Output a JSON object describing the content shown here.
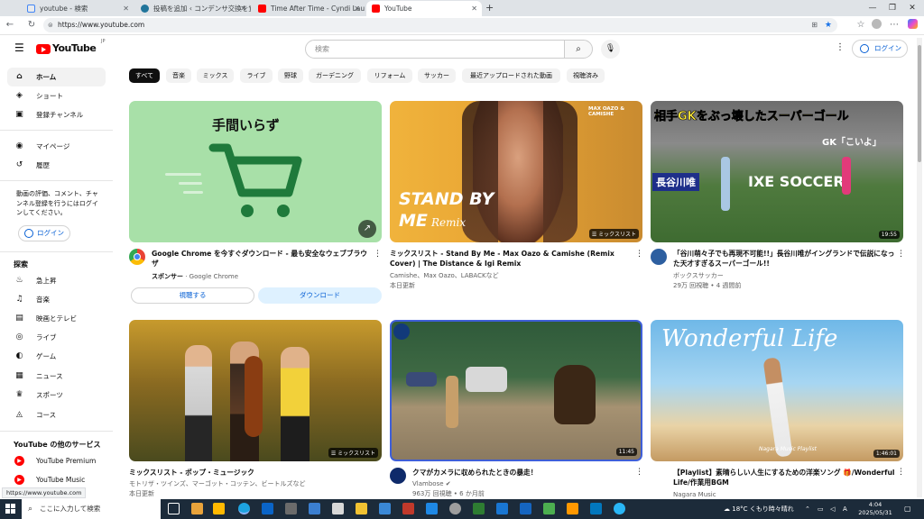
{
  "browser": {
    "tabs": [
      {
        "title": "youtube - 検索",
        "color": "#4285f4"
      },
      {
        "title": "投稿を追加 ‹ コンデンサ交換を覚え…",
        "color": "#21759b"
      },
      {
        "title": "Time After Time - Cyndi Lauper (L…",
        "color": "#ff0000"
      },
      {
        "title": "YouTube",
        "color": "#ff0000"
      }
    ],
    "new_tab": "+",
    "url": "https://www.youtube.com",
    "status_url": "https://www.youtube.com"
  },
  "youtube": {
    "logo_text": "YouTube",
    "logo_region": "JP",
    "search_placeholder": "検索",
    "login_label": "ログイン",
    "sidebar": {
      "main": [
        {
          "label": "ホーム",
          "icon": "home-icon",
          "glyph": "⌂"
        },
        {
          "label": "ショート",
          "icon": "shorts-icon",
          "glyph": "◈"
        },
        {
          "label": "登録チャンネル",
          "icon": "subscriptions-icon",
          "glyph": "▣"
        }
      ],
      "you": [
        {
          "label": "マイページ",
          "icon": "user-icon",
          "glyph": "◉"
        },
        {
          "label": "履歴",
          "icon": "history-icon",
          "glyph": "↺"
        }
      ],
      "signin_text": "動画の評価、コメント、チャンネル登録を行うにはログインしてください。",
      "signin_button": "ログイン",
      "explore_heading": "探索",
      "explore": [
        {
          "label": "急上昇",
          "icon": "trending-icon",
          "glyph": "♨"
        },
        {
          "label": "音楽",
          "icon": "music-icon",
          "glyph": "♫"
        },
        {
          "label": "映画とテレビ",
          "icon": "movies-icon",
          "glyph": "▤"
        },
        {
          "label": "ライブ",
          "icon": "live-icon",
          "glyph": "◎"
        },
        {
          "label": "ゲーム",
          "icon": "gaming-icon",
          "glyph": "◐"
        },
        {
          "label": "ニュース",
          "icon": "news-icon",
          "glyph": "▦"
        },
        {
          "label": "スポーツ",
          "icon": "sports-icon",
          "glyph": "♛"
        },
        {
          "label": "コース",
          "icon": "courses-icon",
          "glyph": "◬"
        }
      ],
      "more_heading": "YouTube の他のサービス",
      "more": [
        {
          "label": "YouTube Premium",
          "icon": "youtube-premium-icon"
        },
        {
          "label": "YouTube Music",
          "icon": "youtube-music-icon"
        }
      ]
    },
    "chips": [
      "すべて",
      "音楽",
      "ミックス",
      "ライブ",
      "野球",
      "ガーデニング",
      "リフォーム",
      "サッカー",
      "最近アップロードされた動画",
      "視聴済み"
    ],
    "ad": {
      "thumb_text": "手間いらず",
      "title": "Google Chrome を今すぐダウンロード - 最も安全なウェブブラウザ",
      "sponsor_label": "スポンサー",
      "sponsor_name": "· Google Chrome",
      "btn_watch": "視聴する",
      "btn_download": "ダウンロード"
    },
    "videos": [
      {
        "thumb_text1": "STAND BY",
        "thumb_text2": "ME",
        "thumb_text3": "Remix",
        "thumb_corner": "MAX OAZO & CAMISHE",
        "badge": "ミックスリスト",
        "title": "ミックスリスト - Stand By Me - Max Oazo & Camishe (Remix Cover) | The Distance & Igi Remix",
        "meta1": "Camishe、Max Oazo、LABACKなど",
        "meta2": "本日更新"
      },
      {
        "thumb_text1": "相手GKをぶっ壊したスーパーゴール",
        "thumb_text2": "GK「こいよ」",
        "thumb_text3": "長谷川唯",
        "thumb_text4": "IXE SOCCER",
        "badge": "19:55",
        "title": "「谷川萌々子でも再現不可能!!」長谷川唯がイングランドで伝説になった天才すぎるスーパーゴール!!",
        "meta1": "ボックスサッカー",
        "meta2": "29万 回視聴 • 4 週間前"
      },
      {
        "badge": "ミックスリスト",
        "title": "ミックスリスト - ポップ・ミュージック",
        "meta1": "モトリザ・ツインズ、マーゴット・コッテン、ビートルズなど",
        "meta2": "本日更新"
      },
      {
        "badge": "11:45",
        "title": "クマがカメラに収められたときの暴走！",
        "meta1": "Vlambose ✔",
        "meta2": "963万 回視聴 • 6 か月前"
      },
      {
        "thumb_text1": "Wonderful Life",
        "thumb_text2": "Nagara Music Playlist",
        "badge": "1:46:01",
        "title": "【Playlist】素晴らしい人生にするための洋楽ソング 🎁/Wonderful Life/作業用BGM",
        "meta1": "Nagara Music",
        "meta2": ""
      }
    ]
  },
  "taskbar": {
    "search_placeholder": "ここに入力して検索",
    "weather": "18°C くもり時々晴れ",
    "ime": "A",
    "time": "4:04",
    "date": "2025/05/31"
  }
}
